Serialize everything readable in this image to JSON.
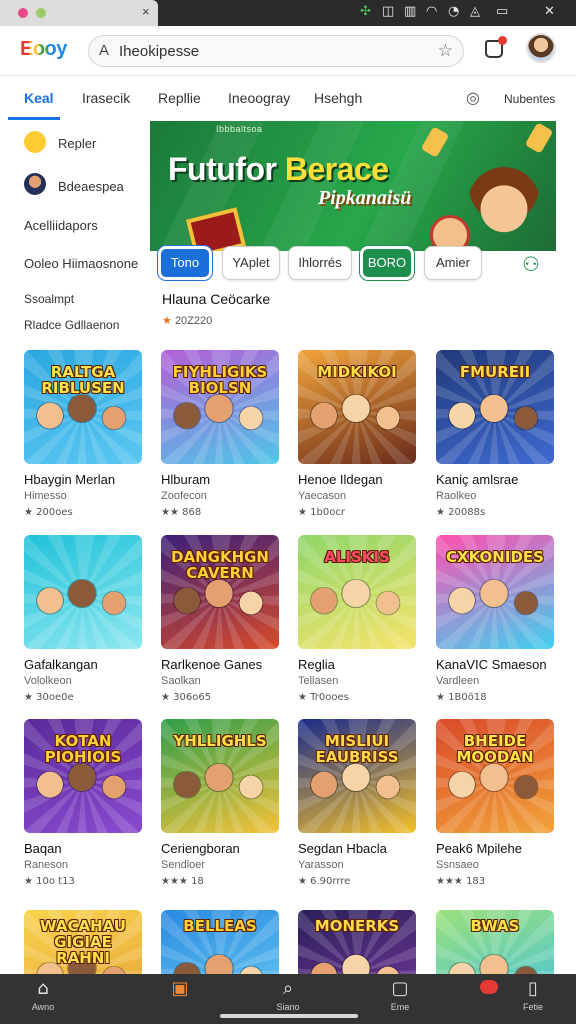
{
  "window": {
    "close_glyph": "×"
  },
  "header": {
    "logo_text": "Eooy",
    "search_value": "Iheokipesse",
    "search_icon_glyph": "A",
    "favorite_glyph": "☆"
  },
  "nav": {
    "tabs": [
      {
        "label": "Keal",
        "active": true
      },
      {
        "label": "Irasecik"
      },
      {
        "label": "Repllie"
      },
      {
        "label": "Ineoogray"
      },
      {
        "label": "Hsehgh"
      },
      {
        "label": "Nubentes"
      }
    ]
  },
  "sidebar": {
    "items": [
      {
        "label": "Repler"
      },
      {
        "label": "Bdeaespea"
      },
      {
        "label": "Acelliidapors"
      },
      {
        "label": "Ooleo Hiimaosnone"
      },
      {
        "label": "Ssoalmpt"
      },
      {
        "label": "Rladce Gdllaenon"
      }
    ]
  },
  "banner": {
    "small_text": "Ibbbaltsoa",
    "title_white": "Futufor ",
    "title_yellow": "Berace",
    "subtitle": "Pipkanaisü"
  },
  "chips": [
    {
      "label": "Tono",
      "style": "blue"
    },
    {
      "label": "YAplet",
      "style": "plain"
    },
    {
      "label": "Ihlorrés",
      "style": "plain"
    },
    {
      "label": "BORO",
      "style": "green"
    },
    {
      "label": "Amier",
      "style": "plain"
    }
  ],
  "featured": {
    "title": "Hlauna Ceöcarke",
    "meta": "20Z220"
  },
  "games": [
    {
      "title_art": "RALTGA RIBLUSEN",
      "name": "Hbaygin Merlan",
      "sub": "Himesso",
      "rating": "★ 200oes",
      "palette": [
        "#2aa7e0",
        "#5bc7f2"
      ],
      "title_color": "#ffe14a"
    },
    {
      "title_art": "FIYHLIGIKS BIOLSN",
      "name": "Hlburam",
      "sub": "Zoofecon",
      "rating": "★★ 868",
      "palette": [
        "#b35fd6",
        "#4cc6e8"
      ],
      "title_color": "#ffcf3a"
    },
    {
      "title_art": "MIDKIKOI",
      "name": "Henoe Ildegan",
      "sub": "Yaecason",
      "rating": "★ 1b0ocr",
      "palette": [
        "#f2a33a",
        "#6a2b1a"
      ],
      "title_color": "#ffdf4a"
    },
    {
      "title_art": "FMUREII",
      "name": "Kaniç amlsrae",
      "sub": "Raolkeo",
      "rating": "★ 20088s",
      "palette": [
        "#203a7a",
        "#3f6ad0"
      ],
      "title_color": "#ffd84a"
    },
    {
      "title_art": "",
      "name": "Gafalkangan",
      "sub": "Vololkeon",
      "rating": "★ 30oe0e",
      "palette": [
        "#1fc1d9",
        "#8ee8f0"
      ],
      "title_color": "#ffe14a"
    },
    {
      "title_art": "DANGKHGN CAVERN",
      "name": "Rarlkenoe Ganes",
      "sub": "Saolkan",
      "rating": "★ 306o65",
      "palette": [
        "#3b1f7a",
        "#d84a2a"
      ],
      "title_color": "#ffcf3a"
    },
    {
      "title_art": "ALISKIS",
      "name": "Reglia",
      "sub": "Tellasen",
      "rating": "★ Tr0ooes",
      "palette": [
        "#8fd66a",
        "#f7e46a"
      ],
      "title_color": "#ff4a6a"
    },
    {
      "title_art": "CXKONIDES",
      "name": "KanaVIC Smaeson",
      "sub": "Vardleen",
      "rating": "★ 1B0ö18",
      "palette": [
        "#ff4fb0",
        "#3fd0f0"
      ],
      "title_color": "#ffe14a"
    },
    {
      "title_art": "KOTAN PIOHIOIS",
      "name": "Baqan",
      "sub": "Raneson",
      "rating": "★ 10o t13",
      "palette": [
        "#5a2a9a",
        "#8a4ad0"
      ],
      "title_color": "#ffcf3a"
    },
    {
      "title_art": "YHLLIGHLS",
      "name": "Ceriengboran",
      "sub": "Sendloer",
      "rating": "★★★ 18",
      "palette": [
        "#2f9e4a",
        "#f4c23a"
      ],
      "title_color": "#ffdf4a"
    },
    {
      "title_art": "MISLIUI EAUBRISS",
      "name": "Segdan Hbacla",
      "sub": "Yarasson",
      "rating": "★ 6.90rrre",
      "palette": [
        "#1a2a8a",
        "#f3c02a"
      ],
      "title_color": "#ffd84a"
    },
    {
      "title_art": "BHEIDE MOODAN",
      "name": "Peak6 Mpilehe",
      "sub": "Ssnsaeo",
      "rating": "★★★ 183",
      "palette": [
        "#d94a2a",
        "#f2a33a"
      ],
      "title_color": "#ffe14a"
    },
    {
      "title_art": "WACAHAU GIGIAE RAHNI",
      "name": "",
      "sub": "",
      "rating": "",
      "palette": [
        "#f7d24a",
        "#e8a23a"
      ],
      "title_color": "#ffe14a"
    },
    {
      "title_art": "BELLEAS",
      "name": "",
      "sub": "",
      "rating": "",
      "palette": [
        "#2a8ae0",
        "#6fd0f5"
      ],
      "title_color": "#ffcf3a"
    },
    {
      "title_art": "MONERKS",
      "name": "",
      "sub": "",
      "rating": "",
      "palette": [
        "#2a1f5a",
        "#7a3aa0"
      ],
      "title_color": "#ffd84a"
    },
    {
      "title_art": "BWAS",
      "name": "",
      "sub": "",
      "rating": "",
      "palette": [
        "#9be07a",
        "#3fc0e8"
      ],
      "title_color": "#ffe14a"
    }
  ],
  "bottom_nav": [
    {
      "label": "Awno",
      "icon": "home-icon",
      "glyph": "⌂"
    },
    {
      "label": "",
      "icon": "apps-icon",
      "glyph": "▣"
    },
    {
      "label": "Siano",
      "icon": "search-icon",
      "glyph": "⌕"
    },
    {
      "label": "Eme",
      "icon": "library-icon",
      "glyph": "▢"
    },
    {
      "label": "",
      "icon": "notifications-icon",
      "glyph": ""
    },
    {
      "label": "Fetie",
      "icon": "bookmark-icon",
      "glyph": "▯"
    }
  ]
}
